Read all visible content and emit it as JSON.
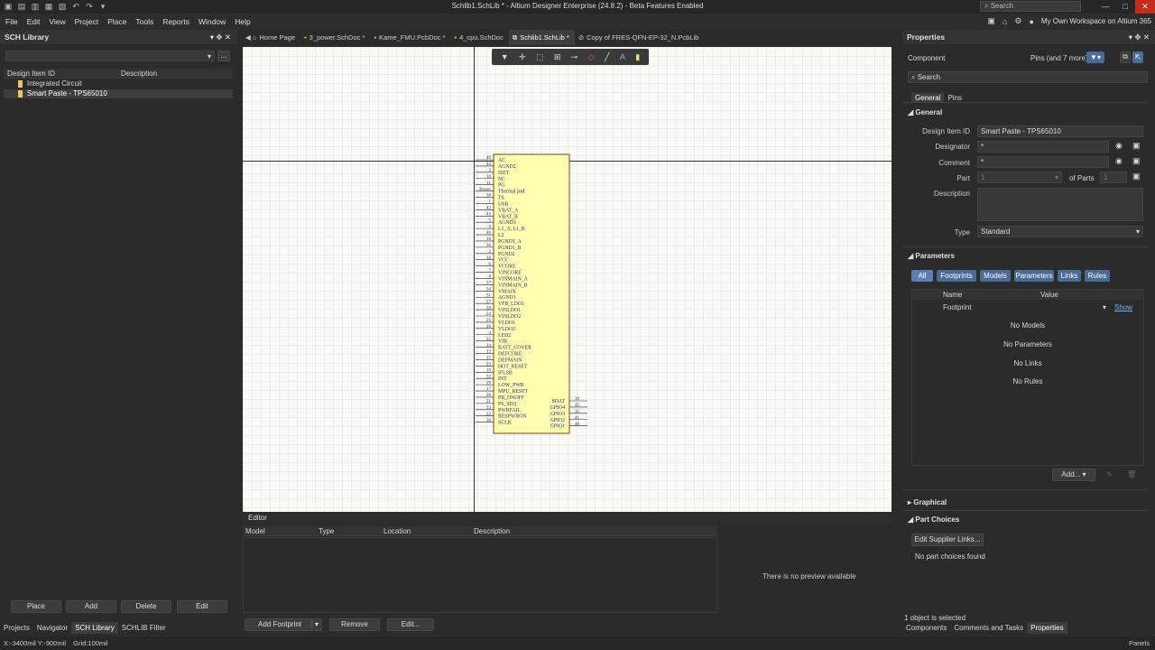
{
  "window": {
    "title": "Schlib1.SchLib * - Altium Designer Enterprise (24.8.2) - Beta Features Enabled",
    "search_placeholder": "Search",
    "workspace": "My Own Workspace on Altium 365",
    "min": "—",
    "max": "□",
    "close": "✕"
  },
  "menu": [
    "File",
    "Edit",
    "View",
    "Project",
    "Place",
    "Tools",
    "Reports",
    "Window",
    "Help"
  ],
  "left_panel": {
    "title": "SCH Library",
    "col_id": "Design Item ID",
    "col_desc": "Description",
    "items": [
      "Integrated Circuit",
      "Smart Paste - TPS65010"
    ],
    "buttons": [
      "Place",
      "Add",
      "Delete",
      "Edit"
    ],
    "bottom_tabs": [
      "Projects",
      "Navigator",
      "SCH Library",
      "SCHLIB Filter"
    ]
  },
  "doc_tabs": [
    "Home Page",
    "3_power.SchDoc *",
    "Kame_FMU.PcbDoc *",
    "4_cpu.SchDoc",
    "Schlib1.SchLib *",
    "Copy of FRES-QFN-EP-32_N.PcbLib"
  ],
  "component": {
    "left_pins": [
      {
        "n": "40",
        "name": "AC"
      },
      {
        "n": "44",
        "name": "AGND2"
      },
      {
        "n": "3",
        "name": "ISET"
      },
      {
        "n": "10",
        "name": "NC"
      },
      {
        "n": "11",
        "name": "PG"
      },
      {
        "n": "Power",
        "name": "Thermal pad"
      },
      {
        "n": "38",
        "name": "TS"
      },
      {
        "n": "1",
        "name": "USB"
      },
      {
        "n": "42",
        "name": "VBAT_A"
      },
      {
        "n": "43",
        "name": "VBAT_B"
      },
      {
        "n": "5",
        "name": "AGND3"
      },
      {
        "n": "9",
        "name": "L1_A, L1_B"
      },
      {
        "n": "46",
        "name": "L2"
      },
      {
        "n": "16",
        "name": "PGND1_A"
      },
      {
        "n": "36",
        "name": "PGND1_B"
      },
      {
        "n": "2",
        "name": "PGND2"
      },
      {
        "n": "18",
        "name": "VCC"
      },
      {
        "n": "6",
        "name": "VCORE"
      },
      {
        "n": "7",
        "name": "VINCORE"
      },
      {
        "n": "8",
        "name": "VINMAIN_A"
      },
      {
        "n": "37",
        "name": "VINMAIN_B"
      },
      {
        "n": "34",
        "name": "VMAIN"
      },
      {
        "n": "31",
        "name": "AGND1"
      },
      {
        "n": "27",
        "name": "VFB_LDO1"
      },
      {
        "n": "28",
        "name": "VINLDO1"
      },
      {
        "n": "24",
        "name": "VINLDO2"
      },
      {
        "n": "25",
        "name": "VLDO1"
      },
      {
        "n": "26",
        "name": "VLDO2"
      },
      {
        "n": "4",
        "name": "LED2"
      },
      {
        "n": "35",
        "name": "VIB"
      },
      {
        "n": "14",
        "name": "BATT_COVER"
      },
      {
        "n": "13",
        "name": "DEFCORE"
      },
      {
        "n": "15",
        "name": "DEFMAIN"
      },
      {
        "n": "23",
        "name": "HOT_RESET"
      },
      {
        "n": "19",
        "name": "IFLSB"
      },
      {
        "n": "32",
        "name": "INT"
      },
      {
        "n": "29",
        "name": "LOW_PWR"
      },
      {
        "n": "17",
        "name": "MPU_RESET"
      },
      {
        "n": "20",
        "name": "PB_ONOFF"
      },
      {
        "n": "21",
        "name": "PS_SEQ"
      },
      {
        "n": "33",
        "name": "PWRFAIL"
      },
      {
        "n": "22",
        "name": "RESPWRON"
      },
      {
        "n": "30",
        "name": "SCLK"
      }
    ],
    "right_pins": [
      {
        "n": "39",
        "name": "SDAT"
      },
      {
        "n": "45",
        "name": "GPIO4"
      },
      {
        "n": "12",
        "name": "GPIO3"
      },
      {
        "n": "41",
        "name": "GPIO2"
      },
      {
        "n": "48",
        "name": "GPIO1"
      }
    ]
  },
  "editor": {
    "title": "Editor",
    "cols": [
      "Model",
      "Type",
      "Location",
      "Description"
    ],
    "no_preview": "There is no preview available",
    "add_footprint": "Add Footprint",
    "remove": "Remove",
    "edit": "Edit..."
  },
  "properties": {
    "title": "Properties",
    "context": "Component",
    "filter_summary": "Pins (and 7 more)",
    "search_placeholder": "Search",
    "tabs": [
      "General",
      "Pins"
    ],
    "general_label": "General",
    "design_item_id_label": "Design Item ID",
    "design_item_id": "Smart Paste - TPS65010",
    "designator_label": "Designator",
    "designator": "*",
    "comment_label": "Comment",
    "comment": "*",
    "part_label": "Part",
    "part_value": "1",
    "of_parts_label": "of Parts",
    "of_parts_value": "1",
    "description_label": "Description",
    "type_label": "Type",
    "type_value": "Standard",
    "parameters_label": "Parameters",
    "param_filters": [
      "All",
      "Footprints",
      "Models",
      "Parameters",
      "Links",
      "Rules"
    ],
    "col_name": "Name",
    "col_value": "Value",
    "footprint_row": "Footprint",
    "show": "Show",
    "empty": [
      "No Models",
      "No Parameters",
      "No Links",
      "No Rules"
    ],
    "add": "Add...",
    "graphical": "Graphical",
    "part_choices": "Part Choices",
    "edit_supplier": "Edit Supplier Links...",
    "no_choices": "No part choices found",
    "selected": "1 object is selected",
    "bottom_tabs": [
      "Components",
      "Comments and Tasks",
      "Properties"
    ]
  },
  "status": {
    "coords": "X:-3400mil Y:-900mil",
    "grid": "Grid:100mil",
    "panels": "Panels"
  },
  "colors": {
    "component_fill": "#ffffb0",
    "component_border": "#8a3a1a",
    "accent": "#4a6b96",
    "pin_text": "#2a2a80"
  }
}
